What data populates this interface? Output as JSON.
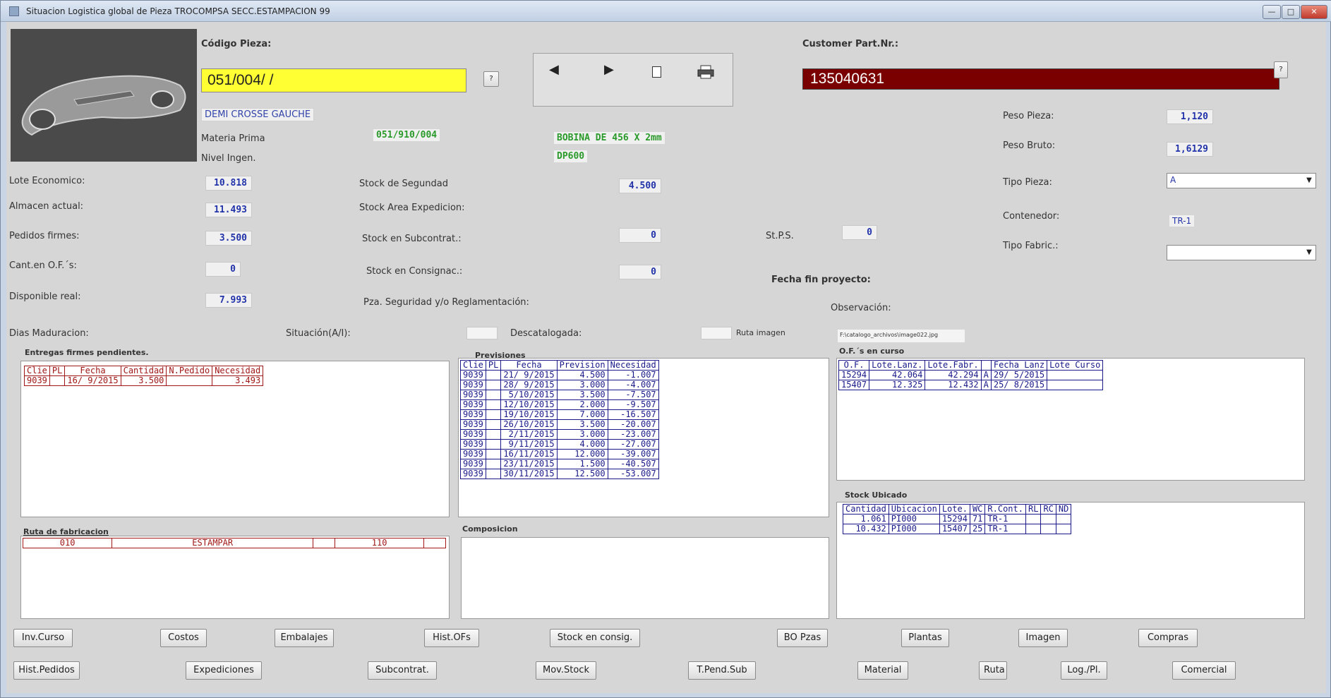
{
  "window": {
    "title": "Situacion Logistica global de Pieza  TROCOMPSA SECC.ESTAMPACION   99",
    "minimize": "—",
    "maximize": "□",
    "close": "✕"
  },
  "header": {
    "codigo_label": "Código Pieza:",
    "codigo_value": "051/004/ /",
    "help_btn": "?",
    "customer_label": "Customer Part.Nr.:",
    "customer_value": "135040631",
    "customer_help_btn": "?",
    "description": "DEMI CROSSE GAUCHE"
  },
  "nav": {
    "prev_icon": "◀",
    "next_icon": "▶",
    "new_icon": "🗋",
    "print_icon": "🖨"
  },
  "materia": {
    "label": "Materia Prima",
    "code": "051/910/004",
    "desc": "BOBINA DE 456 X 2mm",
    "nivel_label": "Nivel Ingen.",
    "nivel_value": "DP600"
  },
  "right_info": {
    "peso_pieza_label": "Peso Pieza:",
    "peso_pieza_value": "1,120",
    "peso_bruto_label": "Peso Bruto:",
    "peso_bruto_value": "1,6129",
    "tipo_pieza_label": "Tipo Pieza:",
    "tipo_pieza_value": "A",
    "contenedor_label": "Contenedor:",
    "contenedor_value": "TR-1",
    "tipo_fabric_label": "Tipo Fabric.:",
    "tipo_fabric_value": "",
    "fecha_fin_label": "Fecha fin proyecto:",
    "observacion_label": "Observación:",
    "image_path": "F:\\catalogo_archivos\\image022.jpg"
  },
  "stock_left": {
    "lote_economico_label": "Lote Economico:",
    "lote_economico_value": "10.818",
    "almacen_label": "Almacen actual:",
    "almacen_value": "11.493",
    "pedidos_label": "Pedidos firmes:",
    "pedidos_value": "3.500",
    "cant_of_label": "Cant.en O.F.´s:",
    "cant_of_value": "0",
    "disponible_label": "Disponible real:",
    "disponible_value": "7.993",
    "dias_label": "Dias Maduracion:"
  },
  "stock_mid": {
    "seguridad_label": "Stock de Segundad",
    "seguridad_value": "4.500",
    "area_label": "Stock Area Expedicion:",
    "subcontrat_label": "Stock en Subcontrat.:",
    "subcontrat_value": "0",
    "consignac_label": "Stock en Consignac.:",
    "consignac_value": "0",
    "pza_label": "Pza. Seguridad y/o Reglamentación:",
    "situacion_label": "Situación(A/I):",
    "descatalogada_label": "Descatalogada:",
    "ruta_imagen_label": "Ruta imagen",
    "stps_label": "St.P.S.",
    "stps_value": "0"
  },
  "entregas": {
    "title": "Entregas firmes pendientes.",
    "headers": [
      "Clie",
      "PL",
      "Fecha",
      "Cantidad",
      "N.Pedido",
      "Necesidad"
    ],
    "rows": [
      [
        "9039",
        "",
        "16/ 9/2015",
        "3.500",
        "",
        "3.493"
      ]
    ]
  },
  "previsiones": {
    "title": "Previsiones",
    "headers": [
      "Clie",
      "PL",
      "Fecha",
      "Prevision",
      "Necesidad"
    ],
    "rows": [
      [
        "9039",
        "",
        "21/ 9/2015",
        "4.500",
        "-1.007"
      ],
      [
        "9039",
        "",
        "28/ 9/2015",
        "3.000",
        "-4.007"
      ],
      [
        "9039",
        "",
        "5/10/2015",
        "3.500",
        "-7.507"
      ],
      [
        "9039",
        "",
        "12/10/2015",
        "2.000",
        "-9.507"
      ],
      [
        "9039",
        "",
        "19/10/2015",
        "7.000",
        "-16.507"
      ],
      [
        "9039",
        "",
        "26/10/2015",
        "3.500",
        "-20.007"
      ],
      [
        "9039",
        "",
        "2/11/2015",
        "3.000",
        "-23.007"
      ],
      [
        "9039",
        "",
        "9/11/2015",
        "4.000",
        "-27.007"
      ],
      [
        "9039",
        "",
        "16/11/2015",
        "12.000",
        "-39.007"
      ],
      [
        "9039",
        "",
        "23/11/2015",
        "1.500",
        "-40.507"
      ],
      [
        "9039",
        "",
        "30/11/2015",
        "12.500",
        "-53.007"
      ]
    ]
  },
  "ofs": {
    "title": "O.F.´s en curso",
    "headers": [
      "O.F.",
      "Lote.Lanz.",
      "Lote.Fabr.",
      "",
      "Fecha Lanz",
      "Lote Curso"
    ],
    "rows": [
      [
        "15294",
        "42.064",
        "42.294",
        "A",
        "29/ 5/2015",
        ""
      ],
      [
        "15407",
        "12.325",
        "12.432",
        "A",
        "25/ 8/2015",
        ""
      ]
    ]
  },
  "stock_ubicado": {
    "title": "Stock Ubicado",
    "headers": [
      "Cantidad",
      "Ubicacion",
      "Lote.",
      "WC",
      "R.Cont.",
      "RL",
      "RC",
      "ND"
    ],
    "rows": [
      [
        "1.061",
        "PI000",
        "15294",
        "71",
        "TR-1",
        "",
        "",
        ""
      ],
      [
        "10.432",
        "PI000",
        "15407",
        "25",
        "TR-1",
        "",
        "",
        ""
      ]
    ]
  },
  "ruta": {
    "title": "Ruta de fabricacion",
    "headers": [
      "010",
      "ESTAMPAR",
      "",
      "110",
      ""
    ],
    "rows": []
  },
  "composicion": {
    "title": "Composicion"
  },
  "buttons_row1": [
    "Inv.Curso",
    "Costos",
    "Embalajes",
    "Hist.OFs",
    "Stock en consig.",
    "BO Pzas",
    "Plantas",
    "Imagen",
    "Compras"
  ],
  "buttons_row2": [
    "Hist.Pedidos",
    "Expediciones",
    "Subcontrat.",
    "Mov.Stock",
    "T.Pend.Sub",
    "Material",
    "Ruta",
    "Log./Pl.",
    "Comercial"
  ],
  "colors": {
    "codigo_bg": "#ffff33",
    "customer_bg": "#7a0000",
    "grid_red": "#a01818",
    "grid_blue": "#1a1a8a"
  }
}
